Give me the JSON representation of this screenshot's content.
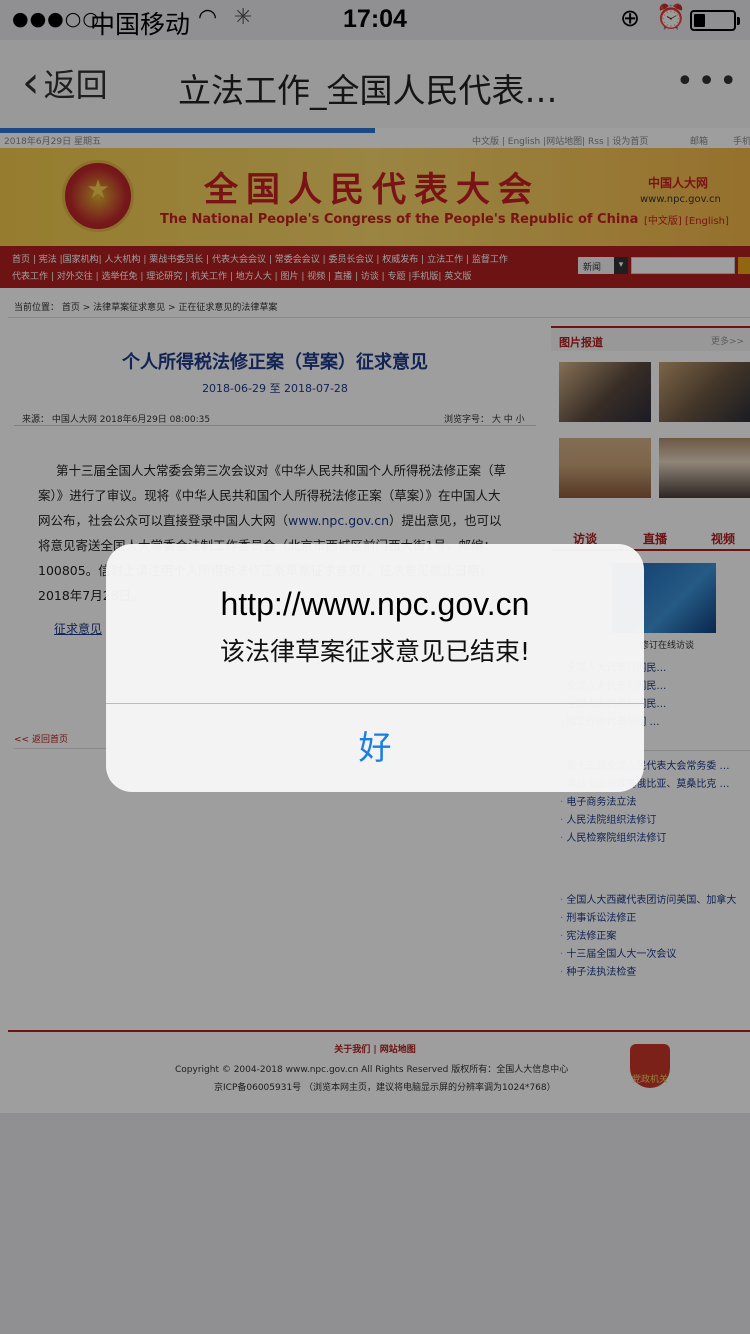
{
  "statusbar": {
    "signal": "●●●○○",
    "carrier": "中国移动",
    "time": "17:04",
    "battery_level": 0.3
  },
  "navbar": {
    "back_label": "返回",
    "title": "立法工作_全国人民代表…",
    "more": "•••",
    "load_progress": 0.5
  },
  "site": {
    "date_line": "2018年6月29日 星期五",
    "top_links": "中文版 | English |网站地图| Rss | 设为首页",
    "mail": "邮箱",
    "mobile": "手机",
    "banner_cn": "全国人民代表大会",
    "banner_en": "The National People's Congress of the People's Republic of China",
    "logo_cn": "中国人大网",
    "logo_url": "www.npc.gov.cn",
    "logo_lang": "[中文版] [English]",
    "nav_row1": "首页 | 宪法 |国家机构| 人大机构 | 栗战书委员长 | 代表大会会议 | 常委会会议 | 委员长会议 | 权威发布 | 立法工作 | 监督工作",
    "nav_row2": "代表工作 | 对外交往 | 选举任免 | 理论研究 | 机关工作 | 地方人大 | 图片 | 视频 | 直播 | 访谈 | 专题 |手机版| 英文版",
    "search_select": "新闻",
    "breadcrumb": "当前位置： 首页 >   法律草案征求意见 > 正在征求意见的法律草案",
    "article_title": "个人所得税法修正案（草案）征求意见",
    "article_dates": "2018-06-29 至 2018-07-28",
    "article_source": "来源：  中国人大网 2018年6月29日 08:00:35",
    "font_size": "浏览字号：  大 中 小",
    "article_body_1": "第十三届全国人大常委会第三次会议对《中华人民共和国个人所得税法修正案（草案）》进行了审议。现将《中华人民共和国个人所得税法修正案（草案）》在中国人大网公布，社会公众可以直接登录中国人大网（",
    "article_body_link": "www.npc.gov.cn",
    "article_body_2": "）提出意见，也可以将意见寄送全国人大常委会法制工作委员会（北京市西城区前门西大街1号，邮编：100805。信封上请注明个人所得税法修正案草案征求意见）。征求意见截止日期：2018年7月28日。",
    "comment_link": "征求意见",
    "back_home": "<< 返回首页",
    "photo_header": "图片报道",
    "photo_more": "更多>>",
    "tabs": [
      "访谈",
      "直播",
      "视频"
    ],
    "video_caption": "修订在线访谈",
    "side_list_1": [
      "全国人大代表与网民…",
      "全国人大代表与网民…",
      "全国人大代表与网民…",
      "院工作的代表与网 …"
    ],
    "side_list_2": [
      "第十三届全国人民代表大会常务委 …",
      "栗战书出访埃塞俄比亚、莫桑比克 …",
      "电子商务法立法",
      "人民法院组织法修订",
      "人民检察院组织法修订"
    ],
    "side_list_3": [
      "全国人大西藏代表团访问美国、加拿大",
      "刑事诉讼法修正",
      "宪法修正案",
      "十三届全国人大一次会议",
      "种子法执法检查"
    ],
    "footer_links": "关于我们 | 网站地图",
    "footer_copy": "Copyright © 2004-2018 www.npc.gov.cn     All Rights Reserved     版权所有：全国人大信息中心",
    "footer_icp": "京ICP备06005931号  （浏览本网主页，建议将电脑显示屏的分辨率调为1024*768）",
    "footer_badge": "党政机关"
  },
  "alert": {
    "title": "http://www.npc.gov.cn",
    "message": "该法律草案征求意见已结束!",
    "ok_label": "好"
  }
}
